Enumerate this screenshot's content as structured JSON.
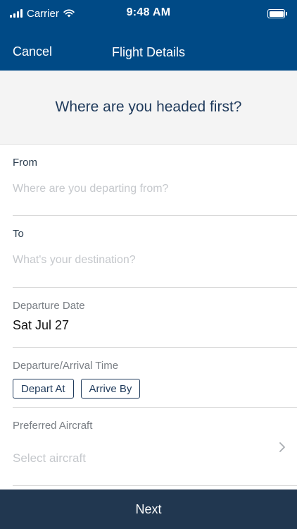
{
  "status_bar": {
    "carrier": "Carrier",
    "time": "9:48 AM"
  },
  "nav": {
    "cancel_label": "Cancel",
    "title": "Flight Details"
  },
  "prompt": {
    "text": "Where are you headed first?"
  },
  "form": {
    "from": {
      "label": "From",
      "placeholder": "Where are you departing from?",
      "value": ""
    },
    "to": {
      "label": "To",
      "placeholder": "What's your destination?",
      "value": ""
    },
    "departure_date": {
      "label": "Departure Date",
      "value": "Sat Jul 27"
    },
    "time_mode": {
      "label": "Departure/Arrival Time",
      "options": [
        "Depart At",
        "Arrive By"
      ]
    },
    "aircraft": {
      "label": "Preferred Aircraft",
      "placeholder": "Select aircraft"
    }
  },
  "footer": {
    "next_label": "Next"
  },
  "colors": {
    "header_bg": "#004a86",
    "footer_bg": "#213750",
    "prompt_bg": "#f4f4f4",
    "accent_text": "#1f3a5b"
  },
  "icons": {
    "signal": "cellular-signal-icon",
    "wifi": "wifi-icon",
    "battery": "battery-icon",
    "chevron": "chevron-right-icon"
  }
}
